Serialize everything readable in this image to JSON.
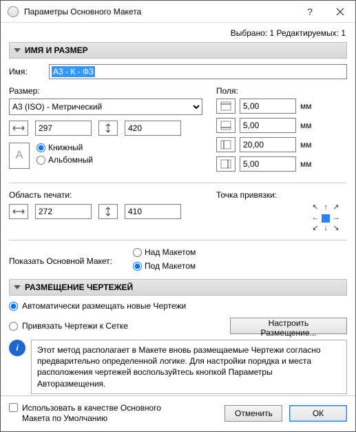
{
  "window": {
    "title": "Параметры Основного Макета"
  },
  "topinfo": "Выбрано: 1 Редактируемых: 1",
  "sections": {
    "name_size": "ИМЯ И РАЗМЕР",
    "placement": "РАЗМЕЩЕНИЕ ЧЕРТЕЖЕЙ"
  },
  "name": {
    "label": "Имя:",
    "value": "А3 - К - Ф3"
  },
  "size": {
    "label": "Размер:",
    "preset": "A3 (ISO) - Метрический",
    "width": "297",
    "height": "420"
  },
  "orientation": {
    "portrait": "Книжный",
    "landscape": "Альбомный"
  },
  "margins": {
    "label": "Поля:",
    "unit": "мм",
    "top": "5,00",
    "bottom": "5,00",
    "left": "20,00",
    "right": "5,00"
  },
  "print_area": {
    "label": "Область печати:",
    "width": "272",
    "height": "410"
  },
  "anchor": {
    "label": "Точка привязки:"
  },
  "show_master": {
    "label": "Показать Основной Макет:",
    "above": "Над Макетом",
    "below": "Под Макетом"
  },
  "placement": {
    "auto": "Автоматически размещать новые Чертежи",
    "snap": "Привязать Чертежи к Сетке",
    "config_btn": "Настроить Размещение..."
  },
  "info": "Этот метод располагает в Макете вновь размещаемые Чертежи согласно предварительно определенной логике. Для настройки порядка и места расположения чертежей воспользуйтесь кнопкой Параметры Авторазмещения.",
  "footer": {
    "use_default": "Использовать в качестве Основного Макета по Умолчанию",
    "cancel": "Отменить",
    "ok": "ОК"
  }
}
